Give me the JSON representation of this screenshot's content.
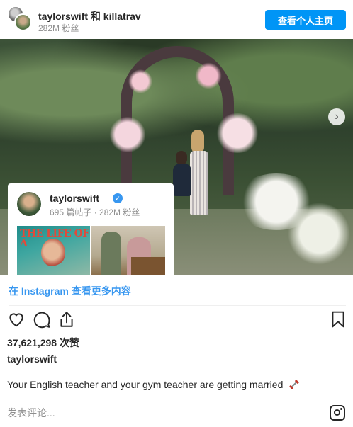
{
  "header": {
    "user1": "taylorswift",
    "connector": "和",
    "user2": "killatrav",
    "followers": "282M 粉丝",
    "view_profile_label": "查看个人主页"
  },
  "carousel": {
    "next_icon": "chevron-right-icon",
    "next_glyph": "›"
  },
  "profile_card": {
    "username": "taylorswift",
    "verified_glyph": "✓",
    "stats": "695 篇帖子 · 282M 粉丝",
    "thumb1_title": "THE LIFE OF A"
  },
  "ig_link": "在 Instagram 查看更多内容",
  "actions": {
    "like_icon": "heart-icon",
    "comment_icon": "comment-icon",
    "share_icon": "share-icon",
    "save_icon": "bookmark-icon"
  },
  "likes": "37,621,298 次赞",
  "post": {
    "username": "taylorswift",
    "caption": "Your English teacher and your gym teacher are getting married",
    "caption_emoji": "dumbbell-emoji"
  },
  "comment": {
    "placeholder": "发表评论..."
  },
  "colors": {
    "accent": "#0095f6",
    "link": "#3897f0",
    "text": "#262626",
    "muted": "#8e8e8e"
  }
}
